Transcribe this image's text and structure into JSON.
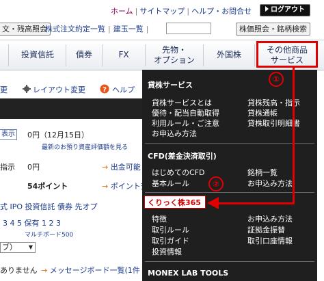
{
  "header": {
    "links": [
      "ホーム",
      "サイトマップ",
      "ヘルプ・お問合せ"
    ],
    "logout_label": "ログアウト"
  },
  "subheader": {
    "left_button": "文・残高照会",
    "links": [
      "株式注文約定一覧",
      "建玉一覧"
    ],
    "search_value": "",
    "right_button": "株価照会・銘柄検索"
  },
  "nav": {
    "items": [
      "投資信託",
      "債券",
      "FX",
      "先物・\nオプション",
      "外国株",
      "その他商品\nサービス"
    ]
  },
  "content": {
    "toolbar_left": "更",
    "layout_change": "レイアウト変更",
    "help": "ヘルプ",
    "show_btn": "表示",
    "balance": "0円（12月15日）",
    "balance_note": "最新のお預り資産評価額を見る",
    "order_btn": "指示",
    "zero_yen": "0円",
    "withdraw_link": "出金可能",
    "points": "54ポイント",
    "points_link": "ポイント交",
    "tabs_row": "式  IPO  投資信託  債券  先オプ",
    "numbers_row": "3    4    5    保有 1    2    3",
    "board": "マルチボード500",
    "dropdown_small": "ブ）",
    "none_text": "ありません",
    "message_link": "メッセージボード一覧(1件"
  },
  "dropdown": {
    "sections": [
      {
        "title": "貸株サービス",
        "left": [
          "貸株サービスとは",
          "優待・配当自動取得",
          "利用ルール・ご注意",
          "お申込み方法"
        ],
        "right": [
          "貸株残高・指示",
          "貸株通帳",
          "貸株取引明細書"
        ]
      },
      {
        "title": "CFD(差金決済取引)",
        "left": [
          "はじめてのCFD",
          "基本ルール"
        ],
        "right": [
          "銘柄一覧",
          "お申込み方法"
        ]
      },
      {
        "title": "くりっく株365",
        "left": [
          "特徴",
          "取引ルール",
          "取引ガイド",
          "投資情報"
        ],
        "right": [
          "お申込み方法",
          "証拠金振替",
          "取引口座情報"
        ]
      },
      {
        "title": "MONEX LAB TOOLS",
        "left": [],
        "right": []
      }
    ]
  },
  "annotations": {
    "badge1": "①",
    "badge2": "②",
    "accent_color": "#e20000"
  }
}
